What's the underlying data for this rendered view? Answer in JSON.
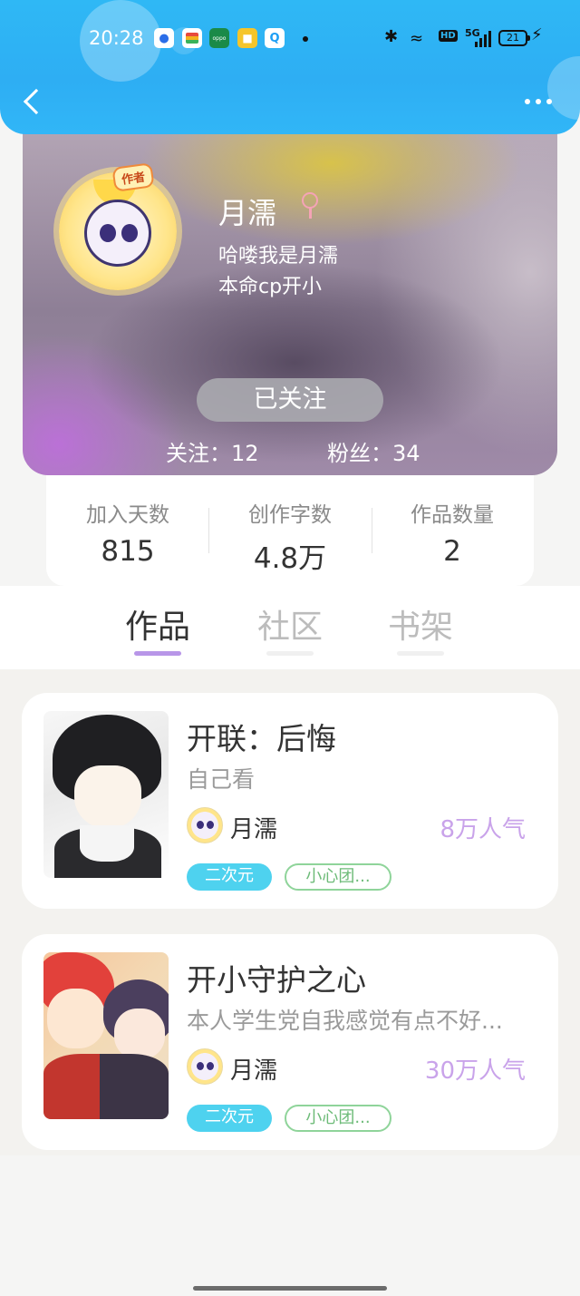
{
  "status_bar": {
    "time": "20:28",
    "network": "5G",
    "hd_label": "HD",
    "battery": "21"
  },
  "profile": {
    "name": "月濡",
    "author_badge": "作者",
    "bio_line1": "哈喽我是月濡",
    "bio_line2": "本命cp开小",
    "follow_button": "已关注",
    "following": "关注：12",
    "fans": "粉丝：34"
  },
  "stats": [
    {
      "label": "加入天数",
      "value": "815"
    },
    {
      "label": "创作字数",
      "value": "4.8万"
    },
    {
      "label": "作品数量",
      "value": "2"
    }
  ],
  "tabs": [
    {
      "label": "作品",
      "active": true
    },
    {
      "label": "社区",
      "active": false
    },
    {
      "label": "书架",
      "active": false
    }
  ],
  "works": [
    {
      "title": "开联：后悔",
      "desc": "自己看",
      "author": "月濡",
      "popularity": "8万人气",
      "tag_category": "二次元",
      "tag_group": "小心团..."
    },
    {
      "title": "开小守护之心",
      "desc": "本人学生党自我感觉有点不好...",
      "author": "月濡",
      "popularity": "30万人气",
      "tag_category": "二次元",
      "tag_group": "小心团..."
    }
  ],
  "colors": {
    "header_blue": "#2fb8f5",
    "accent_purple": "#b896e8",
    "tag_cyan": "#4ed2ef",
    "tag_green": "#8fd49a",
    "popularity": "#c9a3ea"
  }
}
